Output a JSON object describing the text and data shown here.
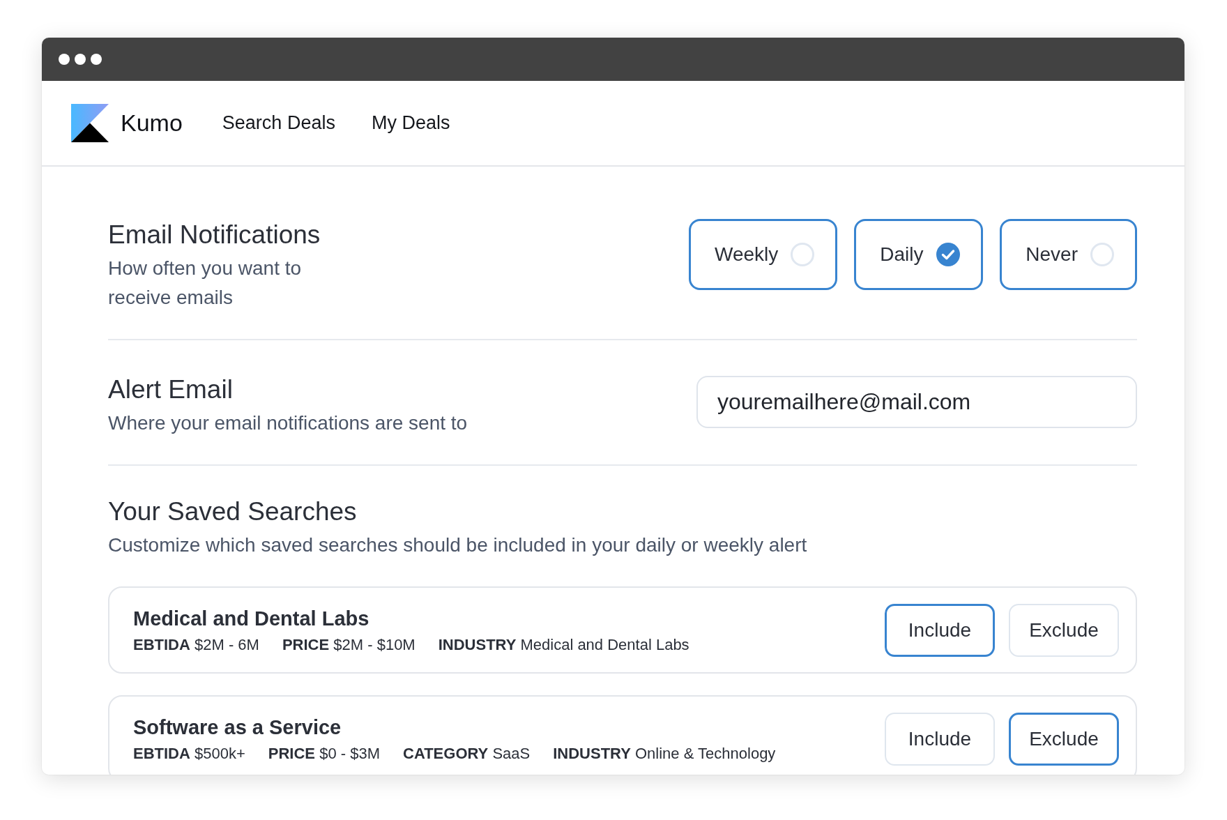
{
  "nav": {
    "brand": "Kumo",
    "links": [
      {
        "label": "Search Deals"
      },
      {
        "label": "My Deals"
      }
    ]
  },
  "email_notifications": {
    "title": "Email Notifications",
    "description": "How often you want to receive emails",
    "options": [
      {
        "label": "Weekly",
        "selected": false
      },
      {
        "label": "Daily",
        "selected": true
      },
      {
        "label": "Never",
        "selected": false
      }
    ]
  },
  "alert_email": {
    "title": "Alert Email",
    "description": "Where your email notifications are sent to",
    "value": "youremailhere@mail.com"
  },
  "saved_searches": {
    "title": "Your Saved Searches",
    "description": "Customize which saved searches should be included in your daily or weekly alert",
    "searches": [
      {
        "name": "Medical and Dental Labs",
        "filters": [
          {
            "label": "EBTIDA",
            "value": "$2M - 6M"
          },
          {
            "label": "PRICE",
            "value": "$2M - $10M"
          },
          {
            "label": "INDUSTRY",
            "value": "Medical and Dental Labs"
          }
        ],
        "options": [
          {
            "label": "Include",
            "selected": true
          },
          {
            "label": "Exclude",
            "selected": false
          }
        ]
      },
      {
        "name": "Software as a Service",
        "filters": [
          {
            "label": "EBTIDA",
            "value": "$500k+"
          },
          {
            "label": "PRICE",
            "value": "$0 - $3M"
          },
          {
            "label": "CATEGORY",
            "value": "SaaS"
          },
          {
            "label": "INDUSTRY",
            "value": "Online & Technology"
          }
        ],
        "options": [
          {
            "label": "Include",
            "selected": false
          },
          {
            "label": "Exclude",
            "selected": true
          }
        ]
      }
    ]
  }
}
